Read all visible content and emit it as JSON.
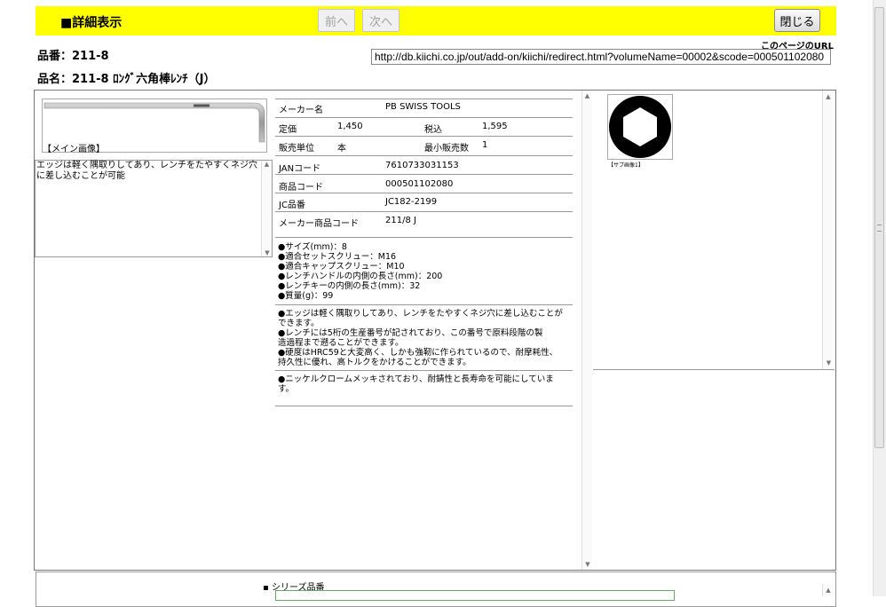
{
  "header": {
    "title": "■詳細表示",
    "prev_label": "前へ",
    "next_label": "次へ",
    "close_label": "閉じる",
    "url_label": "このページのURL",
    "url_value": "http://db.kiichi.co.jp/out/add-on/kiichi/redirect.html?volumeName=00002&scode=000501102080"
  },
  "product": {
    "part_no_line": "品番：211-8",
    "part_name_line": "品名：211-8 ﾛﾝｸﾞ六角棒ﾚﾝﾁ（J）",
    "main_image_caption": "【メイン画像】",
    "short_description": "エッジは軽く隅取りしてあり、レンチをたやすくネジ穴に差し込むことが可能"
  },
  "specs": {
    "maker_label": "メーカー名",
    "maker_value": "PB SWISS TOOLS",
    "list_price_label": "定価",
    "list_price_value": "1,450",
    "tax_in_label": "税込",
    "tax_in_value": "1,595",
    "unit_label": "販売単位",
    "unit_value": "本",
    "min_qty_label": "最小販売数",
    "min_qty_value": "1",
    "jan_label": "JANコード",
    "jan_value": "7610733031153",
    "product_code_label": "商品コード",
    "product_code_value": "000501102080",
    "jc_label": "JC品番",
    "jc_value": "JC182-2199",
    "maker_code_label": "メーカー商品コード",
    "maker_code_value": "211/8 J"
  },
  "features": [
    "●サイズ(mm)：8",
    "●適合セットスクリュー：M16",
    "●適合キャップスクリュー：M10",
    "●レンチハンドルの内側の長さ(mm)：200",
    "●レンチキーの内側の長さ(mm)：32",
    "●質量(g)：99"
  ],
  "notes_1": [
    "●エッジは軽く隅取りしてあり、レンチをたやすくネジ穴に差し込むことが",
    "できます。",
    "●レンチには5桁の生産番号が記されており、この番号で原料段階の製",
    "造過程まで遡ることができます。",
    "●硬度はHRC59と大変高く、しかも強靭に作られているので、耐摩耗性、",
    "持久性に優れ、高トルクをかけることができます。"
  ],
  "notes_2": [
    "●ニッケルクロームメッキされており、耐錆性と長寿命を可能にしていま",
    "す。"
  ],
  "sub_image_caption": "【サブ画像1】",
  "series": {
    "label": "シリーズ品番"
  },
  "colors": {
    "header_bg": "#ffff00"
  }
}
